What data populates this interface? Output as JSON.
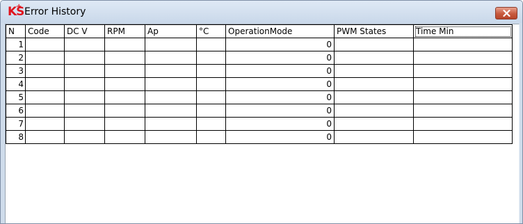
{
  "window": {
    "title": "Error History",
    "close_icon": "close-icon",
    "logo_text": "KS",
    "logo_color": "#e0141e"
  },
  "table": {
    "columns": [
      "N",
      "Code",
      "DC V",
      "RPM",
      "Ap",
      "°C",
      "OperationMode",
      "PWM States",
      "Time Min"
    ],
    "rows": [
      [
        "1",
        "",
        "",
        "",
        "",
        "",
        "0",
        "",
        ""
      ],
      [
        "2",
        "",
        "",
        "",
        "",
        "",
        "0",
        "",
        ""
      ],
      [
        "3",
        "",
        "",
        "",
        "",
        "",
        "0",
        "",
        ""
      ],
      [
        "4",
        "",
        "",
        "",
        "",
        "",
        "0",
        "",
        ""
      ],
      [
        "5",
        "",
        "",
        "",
        "",
        "",
        "0",
        "",
        ""
      ],
      [
        "6",
        "",
        "",
        "",
        "",
        "",
        "0",
        "",
        ""
      ],
      [
        "7",
        "",
        "",
        "",
        "",
        "",
        "0",
        "",
        ""
      ],
      [
        "8",
        "",
        "",
        "",
        "",
        "",
        "0",
        "",
        ""
      ]
    ]
  }
}
